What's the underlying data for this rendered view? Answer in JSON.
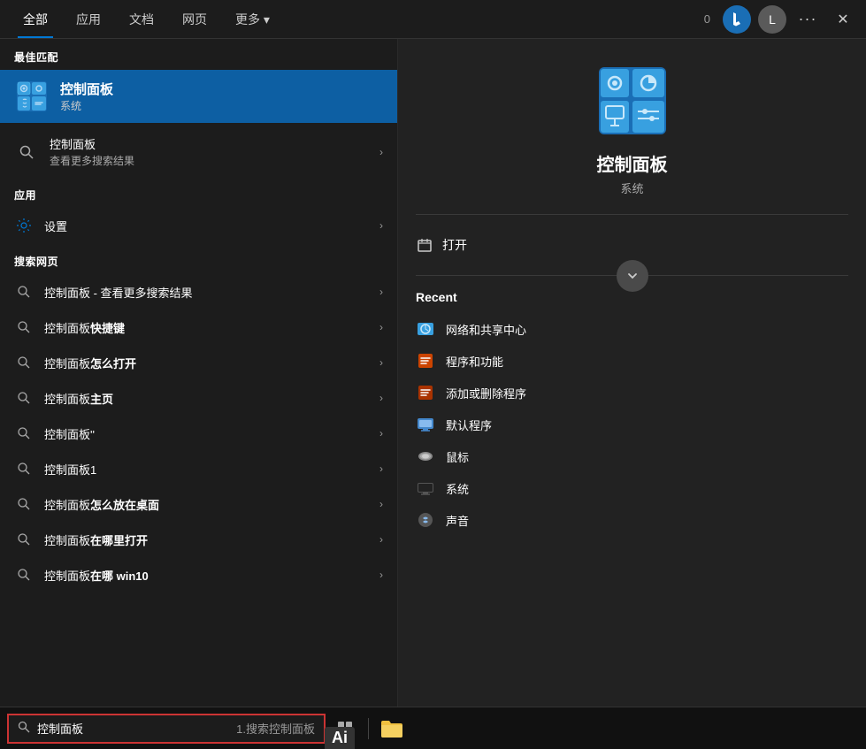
{
  "tabs": {
    "items": [
      {
        "label": "全部",
        "active": true
      },
      {
        "label": "应用",
        "active": false
      },
      {
        "label": "文档",
        "active": false
      },
      {
        "label": "网页",
        "active": false
      },
      {
        "label": "更多 ▾",
        "active": false
      }
    ],
    "badge": "0",
    "user_label": "L",
    "dots_label": "···",
    "close_label": "✕"
  },
  "left": {
    "best_match_title": "最佳匹配",
    "best_match_name": "控制面板",
    "best_match_sub": "系统",
    "search_more_label": "控制面板",
    "search_more_sub": "查看更多搜索结果",
    "apps_title": "应用",
    "settings_label": "设置",
    "web_title": "搜索网页",
    "web_items": [
      {
        "text": "控制面板 - 查看更多搜索结果"
      },
      {
        "text_parts": [
          "控制面板",
          "快捷键"
        ]
      },
      {
        "text_parts": [
          "控制面板",
          "怎么打开"
        ]
      },
      {
        "text_parts": [
          "控制面板",
          "主页"
        ]
      },
      {
        "text_parts": [
          "控制面板",
          "''"
        ]
      },
      {
        "text": "控制面板1"
      },
      {
        "text_parts": [
          "控制面板",
          "怎么放在桌面"
        ]
      },
      {
        "text_parts": [
          "控制面板",
          "在哪里打开"
        ]
      },
      {
        "text_parts": [
          "控制面板",
          "在哪 win10"
        ]
      }
    ]
  },
  "right": {
    "title": "控制面板",
    "subtitle": "系统",
    "open_label": "打开",
    "recent_title": "Recent",
    "recent_items": [
      {
        "icon": "🌐",
        "text": "网络和共享中心"
      },
      {
        "icon": "📋",
        "text": "程序和功能"
      },
      {
        "icon": "📋",
        "text": "添加或删除程序"
      },
      {
        "icon": "🖥",
        "text": "默认程序"
      },
      {
        "icon": "🖱",
        "text": "鼠标"
      },
      {
        "icon": "💻",
        "text": "系统"
      },
      {
        "icon": "🔊",
        "text": "声音"
      }
    ]
  },
  "taskbar": {
    "search_text": "控制面板",
    "search_hint": "1.搜索控制面板",
    "grid_icon": "⊞",
    "folder_icon": "📁"
  },
  "app_label": "Ai"
}
